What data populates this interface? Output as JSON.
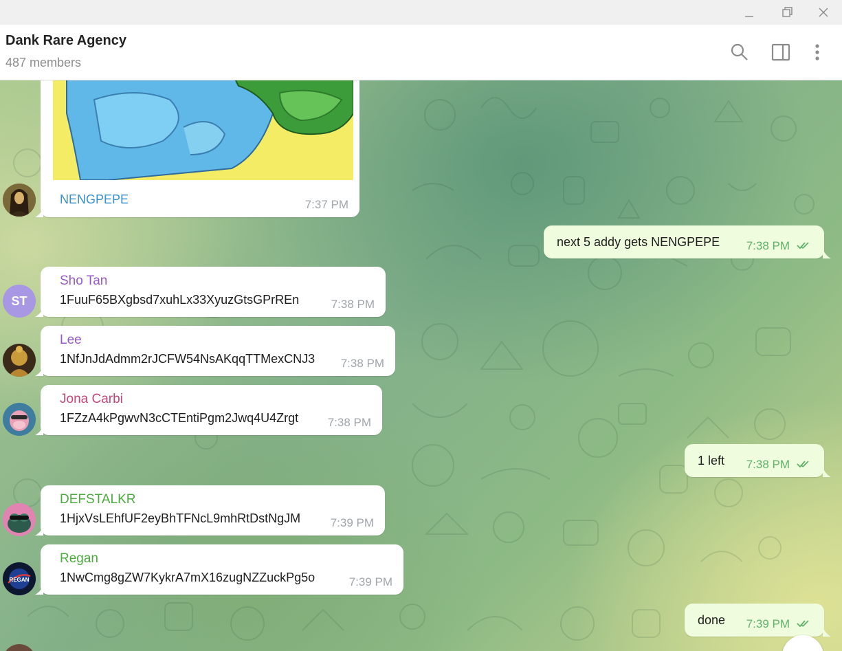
{
  "window": {
    "minimize_icon": "minimize-icon",
    "restore_icon": "restore-icon",
    "close_icon": "close-icon"
  },
  "header": {
    "title": "Dank Rare Agency",
    "subtitle": "487 members",
    "search_icon": "search-icon",
    "side_panel_icon": "side-panel-icon",
    "more_icon": "more-vertical-icon"
  },
  "messages": [
    {
      "direction": "in",
      "type": "image",
      "sender": "",
      "text": "NENGPEPE",
      "time": "7:37 PM",
      "avatar": "mona-lisa"
    },
    {
      "direction": "out",
      "text": "next 5 addy gets NENGPEPE",
      "time": "7:38 PM"
    },
    {
      "direction": "in",
      "sender": "Sho Tan",
      "sender_color": "#9559c9",
      "text": "1FuuF65BXgbsd7xuhLx33XyuzGtsGPrREn",
      "time": "7:38 PM",
      "avatar_initials": "ST",
      "avatar_color": "#a897e3"
    },
    {
      "direction": "in",
      "sender": "Lee",
      "sender_color": "#9559c9",
      "text": "1NfJnJdAdmm2rJCFW54NsAKqqTTMexCNJ3",
      "time": "7:38 PM",
      "avatar": "golden-statue"
    },
    {
      "direction": "in",
      "sender": "Jona Carbi",
      "sender_color": "#c0477a",
      "text": "1FZzA4kPgwvN3cCTEntiPgm2Jwq4U4Zrgt",
      "time": "7:38 PM",
      "avatar": "ape"
    },
    {
      "direction": "out",
      "text": "1 left",
      "time": "7:38 PM"
    },
    {
      "direction": "in",
      "sender": "DEFSTALKR",
      "sender_color": "#4caa3e",
      "text": "1HjxVsLEhfUF2eyBhTFNcL9mhRtDstNgJM",
      "time": "7:39 PM",
      "avatar": "frog"
    },
    {
      "direction": "in",
      "sender": "Regan",
      "sender_color": "#4caa3e",
      "text": "1NwCmg8gZW7KykrA7mX16zugNZZuckPg5o",
      "time": "7:39 PM",
      "avatar": "regan-logo",
      "avatar_text": "REGAN"
    },
    {
      "direction": "out",
      "text": "done",
      "time": "7:39 PM"
    }
  ],
  "colors": {
    "link": "#3a8fc9",
    "incoming_bubble": "#ffffff",
    "outgoing_bubble": "#effdde",
    "outgoing_time": "#5fb26a"
  }
}
